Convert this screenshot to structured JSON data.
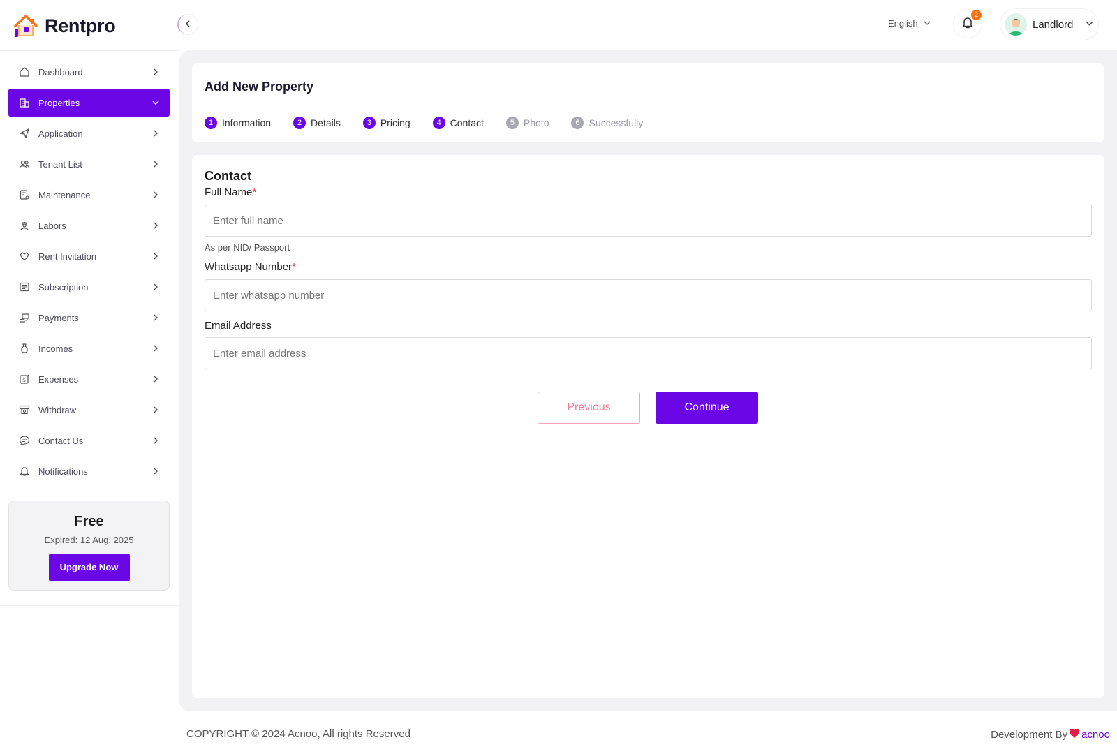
{
  "brand": {
    "name": "Rentpro"
  },
  "sidebar": {
    "items": [
      {
        "label": "Dashboard",
        "icon": "home-icon"
      },
      {
        "label": "Properties",
        "icon": "building-icon",
        "active": true
      },
      {
        "label": "Application",
        "icon": "send-icon"
      },
      {
        "label": "Tenant List",
        "icon": "users-icon"
      },
      {
        "label": "Maintenance",
        "icon": "document-gear-icon"
      },
      {
        "label": "Labors",
        "icon": "worker-icon"
      },
      {
        "label": "Rent Invitation",
        "icon": "handshake-icon"
      },
      {
        "label": "Subscription",
        "icon": "receipt-icon"
      },
      {
        "label": "Payments",
        "icon": "cash-hand-icon"
      },
      {
        "label": "Incomes",
        "icon": "money-bag-icon"
      },
      {
        "label": "Expenses",
        "icon": "wallet-out-icon"
      },
      {
        "label": "Withdraw",
        "icon": "atm-icon"
      },
      {
        "label": "Contact Us",
        "icon": "chat-icon"
      },
      {
        "label": "Notifications",
        "icon": "bell-icon"
      }
    ]
  },
  "plan": {
    "title": "Free",
    "expiry": "Expired: 12 Aug, 2025",
    "upgrade_label": "Upgrade Now"
  },
  "topbar": {
    "language": "English",
    "notification_count": "2",
    "user_name": "Landlord"
  },
  "header": {
    "title": "Add New Property",
    "steps": [
      {
        "num": "1",
        "label": "Information",
        "state": "done"
      },
      {
        "num": "2",
        "label": "Details",
        "state": "done"
      },
      {
        "num": "3",
        "label": "Pricing",
        "state": "done"
      },
      {
        "num": "4",
        "label": "Contact",
        "state": "current"
      },
      {
        "num": "5",
        "label": "Photo",
        "state": "todo"
      },
      {
        "num": "6",
        "label": "Successfully",
        "state": "todo"
      }
    ]
  },
  "form": {
    "section_title": "Contact",
    "full_name": {
      "label": "Full Name",
      "required_mark": "*",
      "placeholder": "Enter full name",
      "value": "",
      "hint": "As per NID/ Passport"
    },
    "whatsapp": {
      "label": "Whatsapp Number",
      "required_mark": "*",
      "placeholder": "Enter whatsapp number",
      "value": ""
    },
    "email": {
      "label": "Email Address",
      "placeholder": "Enter email address",
      "value": ""
    },
    "previous_label": "Previous",
    "continue_label": "Continue"
  },
  "footer": {
    "copyright": "COPYRIGHT © 2024 Acnoo, All rights Reserved",
    "dev_by": "Development By",
    "dev_brand": "acnoo"
  },
  "colors": {
    "accent": "#6b06e6",
    "badge": "#f97316",
    "required": "#e11d48",
    "previous": "#f27a93"
  }
}
